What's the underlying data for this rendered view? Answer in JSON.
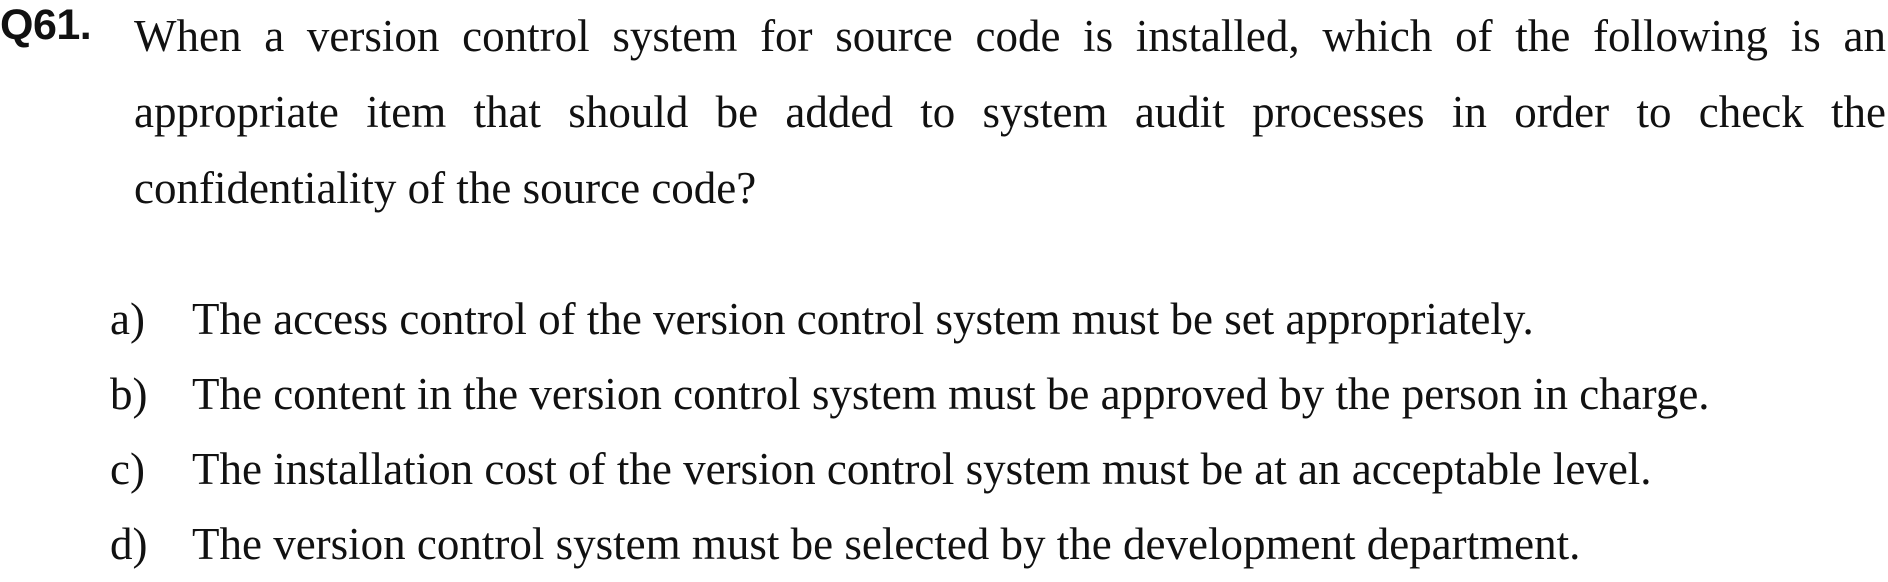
{
  "question": {
    "number": "Q61.",
    "stem": "When a version control system for source code is installed, which of the following is an appropriate item that should be added to system audit processes in order to check the confidentiality of the source code?"
  },
  "options": [
    {
      "letter": "a)",
      "text": "The access control of the version control system must be set appropriately."
    },
    {
      "letter": "b)",
      "text": "The content in the version control system must be approved by the person in charge."
    },
    {
      "letter": "c)",
      "text": "The installation cost of the version control system must be at an acceptable level."
    },
    {
      "letter": "d)",
      "text": "The version control system must be selected by the development department."
    }
  ]
}
